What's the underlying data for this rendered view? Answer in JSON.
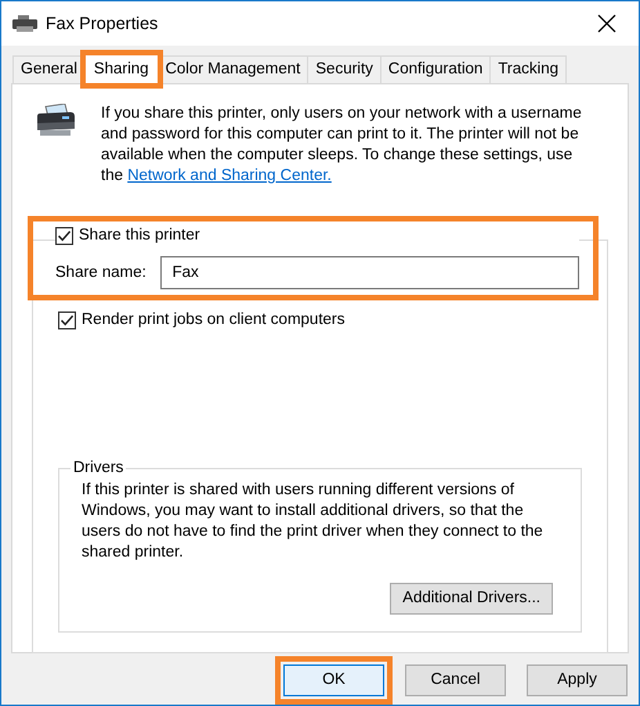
{
  "window": {
    "title": "Fax Properties"
  },
  "tabs": [
    {
      "label": "General",
      "selected": false,
      "highlighted": false
    },
    {
      "label": "Sharing",
      "selected": true,
      "highlighted": true
    },
    {
      "label": "Color Management",
      "selected": false,
      "highlighted": false
    },
    {
      "label": "Security",
      "selected": false,
      "highlighted": false
    },
    {
      "label": "Configuration",
      "selected": false,
      "highlighted": false
    },
    {
      "label": "Tracking",
      "selected": false,
      "highlighted": false
    }
  ],
  "sharing": {
    "description": "If you share this printer, only users on your network with a username and password for this computer can print to it. The printer will not be available when the computer sleeps. To change these settings, use the",
    "link": "Network and Sharing Center.",
    "share_group": {
      "highlighted": true,
      "share_printer": {
        "label": "Share this printer",
        "checked": true
      },
      "share_name": {
        "label": "Share name:",
        "value": "Fax"
      }
    },
    "render_jobs": {
      "label": "Render print jobs on client computers",
      "checked": true
    },
    "drivers": {
      "title": "Drivers",
      "text": "If this printer is shared with users running different versions of Windows, you may want to install additional drivers, so that the users do not have to find the print driver when they connect to the shared printer.",
      "button": "Additional Drivers..."
    }
  },
  "buttons": [
    {
      "label": "OK",
      "default": true,
      "highlighted": true
    },
    {
      "label": "Cancel",
      "default": false,
      "highlighted": false
    },
    {
      "label": "Apply",
      "default": false,
      "highlighted": false
    }
  ]
}
